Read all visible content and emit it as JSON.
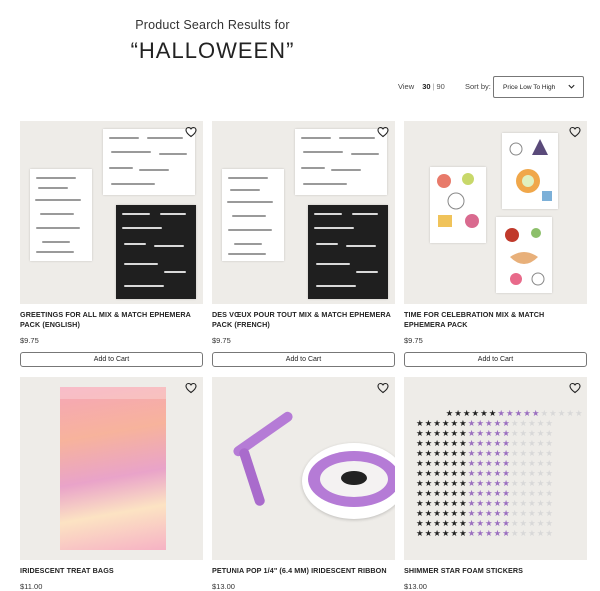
{
  "search": {
    "results_label": "Product Search Results for",
    "query": "“HALLOWEEN”"
  },
  "toolbar": {
    "view_label": "View",
    "view_options": [
      "30",
      "90"
    ],
    "view_selected": "30",
    "view_separator": "|",
    "sort_label": "Sort by:",
    "sort_value": "Price Low To High"
  },
  "products": [
    {
      "title": "GREETINGS FOR ALL MIX & MATCH EPHEMERA PACK (ENGLISH)",
      "price": "$9.75",
      "button": "Add to Cart",
      "image": "ephemera-english"
    },
    {
      "title": "DES VŒUX POUR TOUT MIX & MATCH EPHEMERA PACK (FRENCH)",
      "price": "$9.75",
      "button": "Add to Cart",
      "image": "ephemera-french"
    },
    {
      "title": "TIME FOR CELEBRATION MIX & MATCH EPHEMERA PACK",
      "price": "$9.75",
      "button": "Add to Cart",
      "image": "ephemera-celebration"
    },
    {
      "title": "IRIDESCENT TREAT BAGS",
      "price": "$11.00",
      "image": "treat-bag"
    },
    {
      "title": "PETUNIA POP 1/4\" (6.4 MM) IRIDESCENT RIBBON",
      "price": "$13.00",
      "image": "ribbon-spool"
    },
    {
      "title": "SHIMMER STAR FOAM STICKERS",
      "price": "$13.00",
      "image": "star-stickers"
    }
  ],
  "icons": {
    "wishlist": "heart-outline-icon",
    "dropdown": "chevron-down-icon"
  },
  "colors": {
    "image_background": "#eeece8",
    "ribbon_purple": "#b57bd6"
  }
}
